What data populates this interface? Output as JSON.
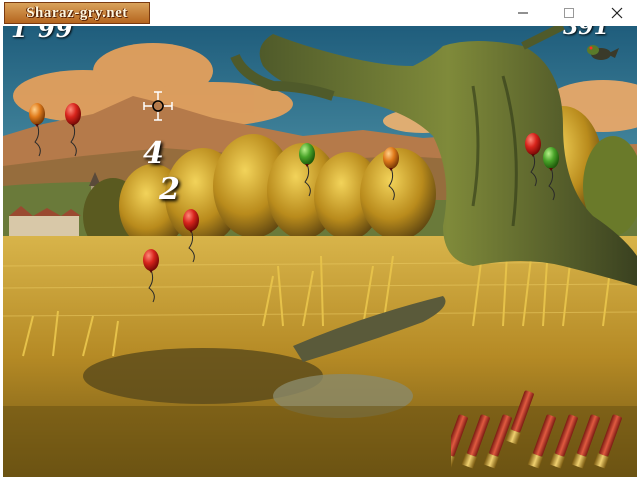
{
  "window": {
    "site_label": "Sharaz-gry.net",
    "buttons": [
      "minimize-icon",
      "maximize-icon",
      "close-icon"
    ]
  },
  "hud": {
    "score_left": "1 99",
    "score_right": "391",
    "hits": [
      "4",
      "2"
    ]
  },
  "colors": {
    "sky": "#2e6f8e",
    "cloud": "#e8a25a",
    "field": "#c9a63a",
    "balloon_red": "#d8241c",
    "balloon_orange": "#e07a1a",
    "balloon_green": "#4aa52a",
    "shell": "#c0392b"
  },
  "balloons": [
    {
      "color": "orange"
    },
    {
      "color": "red"
    },
    {
      "color": "green"
    },
    {
      "color": "orange"
    },
    {
      "color": "red"
    },
    {
      "color": "green"
    },
    {
      "color": "red"
    },
    {
      "color": "red"
    }
  ],
  "ammo": {
    "shells_remaining": 8
  }
}
